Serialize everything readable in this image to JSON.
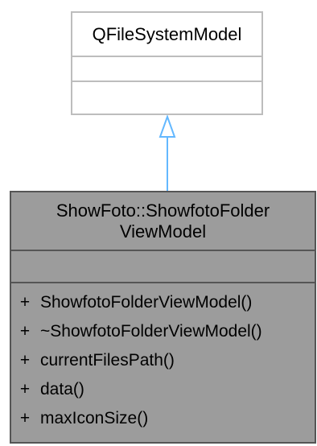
{
  "base_class": {
    "name": "QFileSystemModel"
  },
  "derived_class": {
    "name_line1": "ShowFoto::ShowfotoFolder",
    "name_line2": "ViewModel",
    "methods": [
      {
        "visibility": "+",
        "name": "ShowfotoFolderViewModel()"
      },
      {
        "visibility": "+",
        "name": "~ShowfotoFolderViewModel()"
      },
      {
        "visibility": "+",
        "name": "currentFilesPath()"
      },
      {
        "visibility": "+",
        "name": "data()"
      },
      {
        "visibility": "+",
        "name": "maxIconSize()"
      }
    ]
  },
  "colors": {
    "inheritance_arrow": "#63b8ff",
    "base_border": "#bdbdbd",
    "derived_fill": "#9c9c9c",
    "derived_border": "#555555"
  }
}
